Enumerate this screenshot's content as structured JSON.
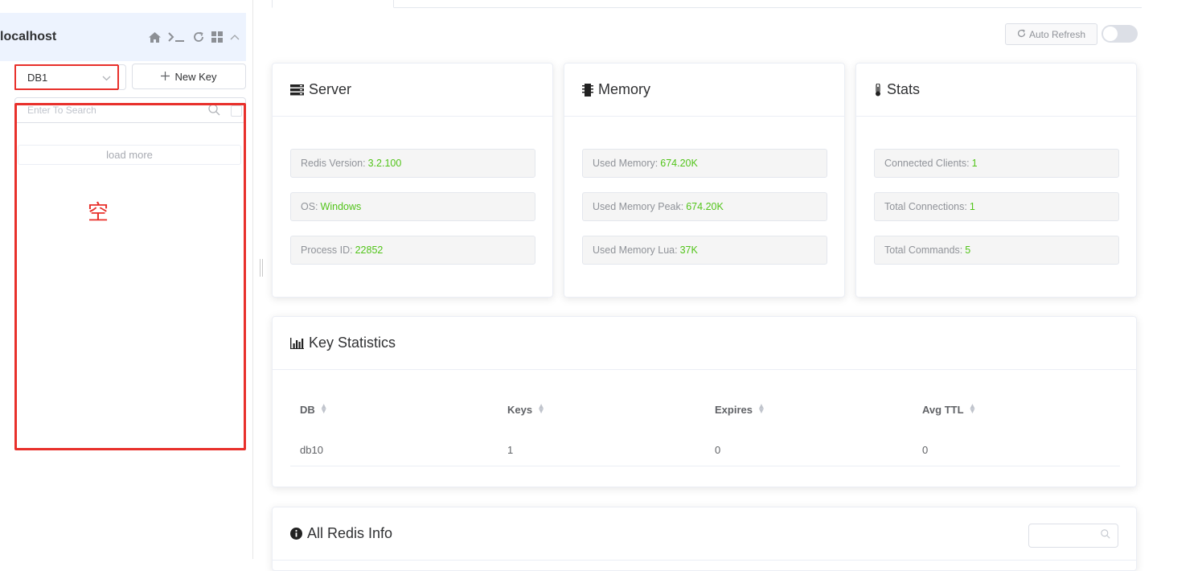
{
  "sidebar": {
    "connection_name": "localhost",
    "icons": [
      "home-icon",
      "terminal-icon",
      "refresh-icon",
      "grid-icon",
      "chevron-up-icon"
    ],
    "db_select": {
      "value": "DB1"
    },
    "new_key_label": "New Key",
    "search": {
      "placeholder": "Enter To Search"
    },
    "load_more_label": "load more",
    "annotation": {
      "empty_label": "空",
      "color": "#e8302b"
    }
  },
  "toolbar": {
    "auto_refresh_label": "Auto Refresh",
    "auto_refresh_on": false
  },
  "cards": {
    "server": {
      "title": "Server",
      "icon": "server-icon",
      "rows": [
        {
          "label": "Redis Version:",
          "value": "3.2.100"
        },
        {
          "label": "OS:",
          "value": "Windows"
        },
        {
          "label": "Process ID:",
          "value": "22852"
        }
      ]
    },
    "memory": {
      "title": "Memory",
      "icon": "memory-chip-icon",
      "rows": [
        {
          "label": "Used Memory:",
          "value": "674.20K"
        },
        {
          "label": "Used Memory Peak:",
          "value": "674.20K"
        },
        {
          "label": "Used Memory Lua:",
          "value": "37K"
        }
      ]
    },
    "stats": {
      "title": "Stats",
      "icon": "thermometer-icon",
      "rows": [
        {
          "label": "Connected Clients:",
          "value": "1"
        },
        {
          "label": "Total Connections:",
          "value": "1"
        },
        {
          "label": "Total Commands:",
          "value": "5"
        }
      ]
    }
  },
  "key_statistics": {
    "title": "Key Statistics",
    "icon": "bar-chart-icon",
    "columns": [
      "DB",
      "Keys",
      "Expires",
      "Avg TTL"
    ],
    "rows": [
      [
        "db10",
        "1",
        "0",
        "0"
      ]
    ]
  },
  "all_info": {
    "title": "All Redis Info",
    "icon": "info-circle-icon"
  },
  "colors": {
    "value_green": "#52c41a",
    "header_bg": "#edf3fe",
    "highlight_red": "#e8302b"
  }
}
